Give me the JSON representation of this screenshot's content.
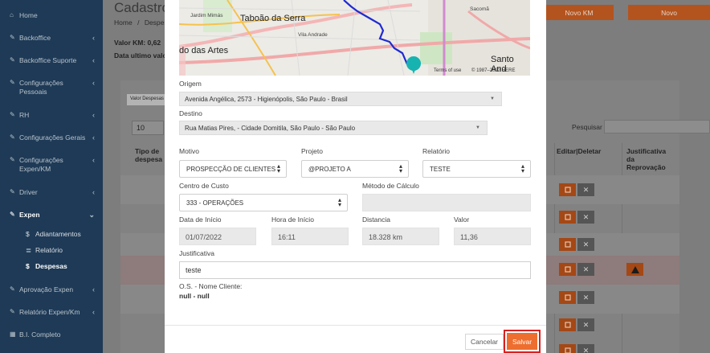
{
  "sidebar": {
    "items": [
      {
        "label": "Home",
        "icon": "home-icon"
      },
      {
        "label": "Backoffice",
        "icon": "edit-icon"
      },
      {
        "label": "Backoffice Suporte",
        "icon": "edit-icon"
      },
      {
        "label": "Configurações Pessoais",
        "icon": "edit-icon"
      },
      {
        "label": "RH",
        "icon": "edit-icon"
      },
      {
        "label": "Configurações Gerais",
        "icon": "edit-icon"
      },
      {
        "label": "Configurações Expen/KM",
        "icon": "edit-icon"
      },
      {
        "label": "Driver",
        "icon": "edit-icon"
      },
      {
        "label": "Expen",
        "icon": "edit-icon"
      },
      {
        "label": "Aprovação Expen",
        "icon": "edit-icon"
      },
      {
        "label": "Relatório Expen/Km",
        "icon": "edit-icon"
      },
      {
        "label": "B.I. Completo",
        "icon": "grid-icon"
      }
    ],
    "sub": [
      {
        "label": "Adiantamentos",
        "icon": "$"
      },
      {
        "label": "Relatório",
        "icon": "≣"
      },
      {
        "label": "Despesas",
        "icon": "$"
      }
    ]
  },
  "background": {
    "title": "Cadastro d",
    "crumb_home": "Home",
    "crumb_sep": "/",
    "crumb_current": "Despes",
    "valor_km": "Valor KM: 0,62",
    "data_ultimo": "Data ultimo valo",
    "btn_novo_km": "Novo KM",
    "btn_novo": "Novo",
    "valor_tab": "Valor Despesas",
    "page_size": "10",
    "search_label": "Pesquisar",
    "th_tipo": "Tipo de despesa",
    "th_edit": "Editar|Deletar",
    "th_just": "Justificativa da Reprovação"
  },
  "modal": {
    "map": {
      "labels": [
        "Jardim Mimás",
        "Taboão da Serra",
        "Sacomã",
        "Vila Andrade",
        "do das Artes",
        "Santo And"
      ],
      "attribution_terms": "Terms of use",
      "attribution_copy": "© 1987–2022 HERE"
    },
    "origem_label": "Origem",
    "origem_value": "Avenida Angélica, 2573 - Higienópolis, São Paulo - Brasil",
    "destino_label": "Destino",
    "destino_value": "Rua Matias Pires, - Cidade Domitila, São Paulo - São Paulo",
    "motivo_label": "Motivo",
    "motivo_value": "PROSPECÇÃO DE CLIENTES",
    "projeto_label": "Projeto",
    "projeto_value": "@PROJETO A",
    "relatorio_label": "Relatório",
    "relatorio_value": "TESTE",
    "centro_label": "Centro de Custo",
    "centro_value": "333 - OPERAÇÕES",
    "metodo_label": "Método de Cálculo",
    "metodo_value": "",
    "data_label": "Data de Início",
    "data_value": "01/07/2022",
    "hora_label": "Hora de Início",
    "hora_value": "16:11",
    "distancia_label": "Distancia",
    "distancia_value": "18.328 km",
    "valor_label": "Valor",
    "valor_value": "11,36",
    "just_label": "Justificativa",
    "just_value": "teste",
    "os_label": "O.S. - Nome Cliente:",
    "os_value": "null - null",
    "cancel_label": "Cancelar",
    "save_label": "Salvar"
  },
  "colors": {
    "sidebar": "#1e3a56",
    "accent": "#ee6e2f",
    "highlight_border": "#d82020",
    "route": "#1f2ad1",
    "map_pin": "#17b3b0"
  }
}
